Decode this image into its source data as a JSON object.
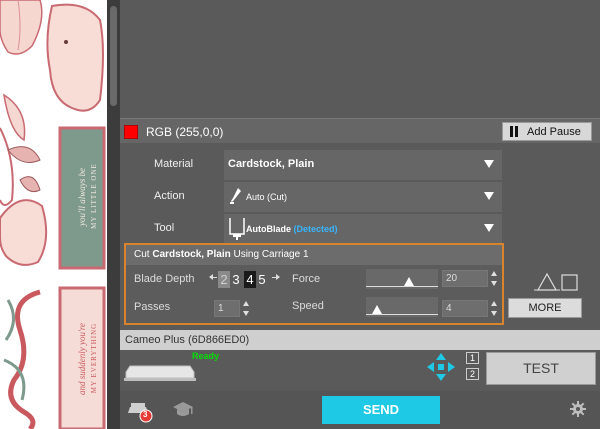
{
  "canvas": {
    "text_top": "you'll always be",
    "text_top_2": "MY LITTLE ONE",
    "text_bottom": "and suddenly you're",
    "text_bottom_2": "MY EVERYTHING",
    "text_welcome": "welcome"
  },
  "color_row": {
    "label": "RGB (255,0,0)",
    "swatch_color": "#ff0000",
    "add_pause_label": "Add Pause"
  },
  "options": {
    "material_label": "Material",
    "material_value": "Cardstock, Plain",
    "action_label": "Action",
    "action_value": "Auto (Cut)",
    "tool_label": "Tool",
    "tool_value": "AutoBlade",
    "tool_detected": "(Detected)"
  },
  "cut_settings": {
    "title_prefix": "Cut",
    "title_material": "Cardstock, Plain",
    "title_suffix": "Using Carriage 1",
    "blade_depth_label": "Blade Depth",
    "blade_depth_digits": [
      "1",
      "2",
      "3",
      "4",
      "5"
    ],
    "blade_depth_selected": "4",
    "force_label": "Force",
    "force_value": "20",
    "force_level": 20,
    "force_max": 33,
    "passes_label": "Passes",
    "passes_value": "1",
    "speed_label": "Speed",
    "speed_value": "4",
    "speed_level": 1,
    "speed_max": 10,
    "more_label": "MORE"
  },
  "device": {
    "name": "Cameo Plus (6D866ED0)",
    "status": "Ready",
    "carriage_1": "1",
    "carriage_2": "2",
    "test_label": "TEST"
  },
  "bottom": {
    "send_label": "SEND",
    "jobs_count": "3"
  },
  "colors": {
    "accent": "#1ec9e6",
    "highlight_border": "#d9832a",
    "ready": "#00e000"
  }
}
